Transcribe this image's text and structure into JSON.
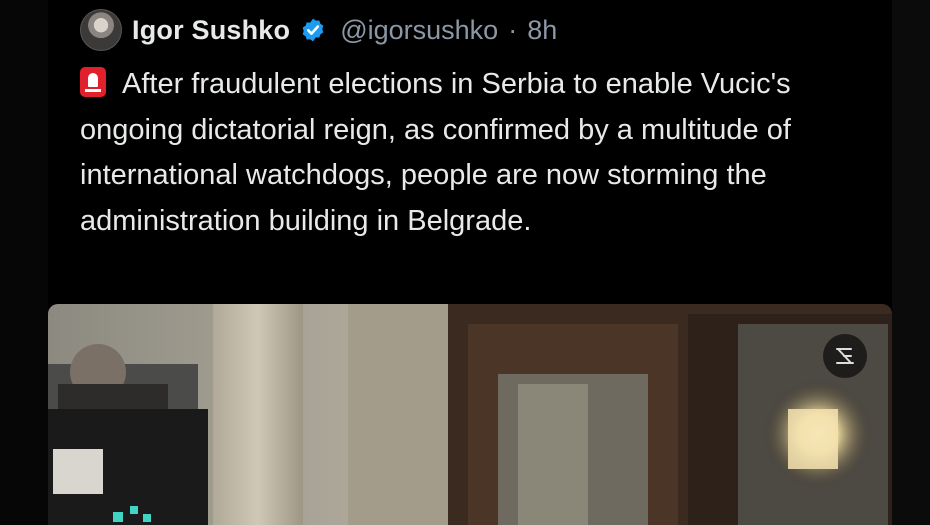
{
  "tweet": {
    "author_name": "Igor Sushko",
    "handle": "@igorsushko",
    "separator": "·",
    "time": "8h",
    "text": "After fraudulent elections in Serbia to enable Vucic's ongoing dictatorial reign, as confirmed by a multitude of international watchdogs, people are now storming the administration building in Belgrade."
  },
  "icons": {
    "verified": "verified-badge-icon",
    "siren": "rotating-light-emoji",
    "media": "media-overlay-icon"
  },
  "colors": {
    "background": "#000000",
    "text": "#e7e9ea",
    "secondary": "#8b98a5",
    "verified": "#1d9bf0",
    "siren": "#e0202b"
  }
}
